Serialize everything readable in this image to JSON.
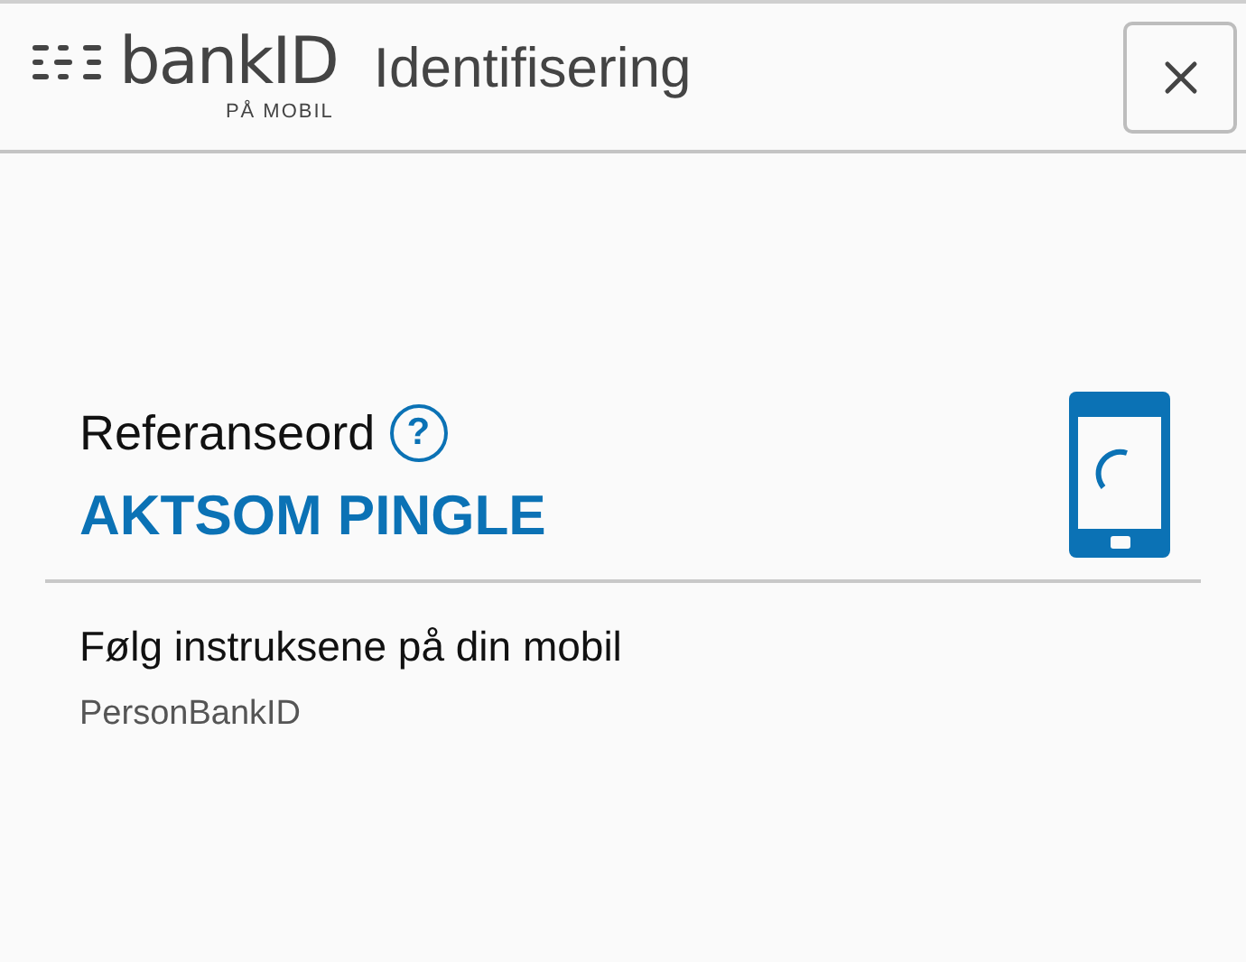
{
  "header": {
    "logo_text": "bankID",
    "logo_subtext": "PÅ MOBIL",
    "title": "Identifisering"
  },
  "reference": {
    "label": "Referanseord",
    "help": "?",
    "words": "AKTSOM PINGLE"
  },
  "instruction": "Følg instruksene på din mobil",
  "identity_type": "PersonBankID"
}
